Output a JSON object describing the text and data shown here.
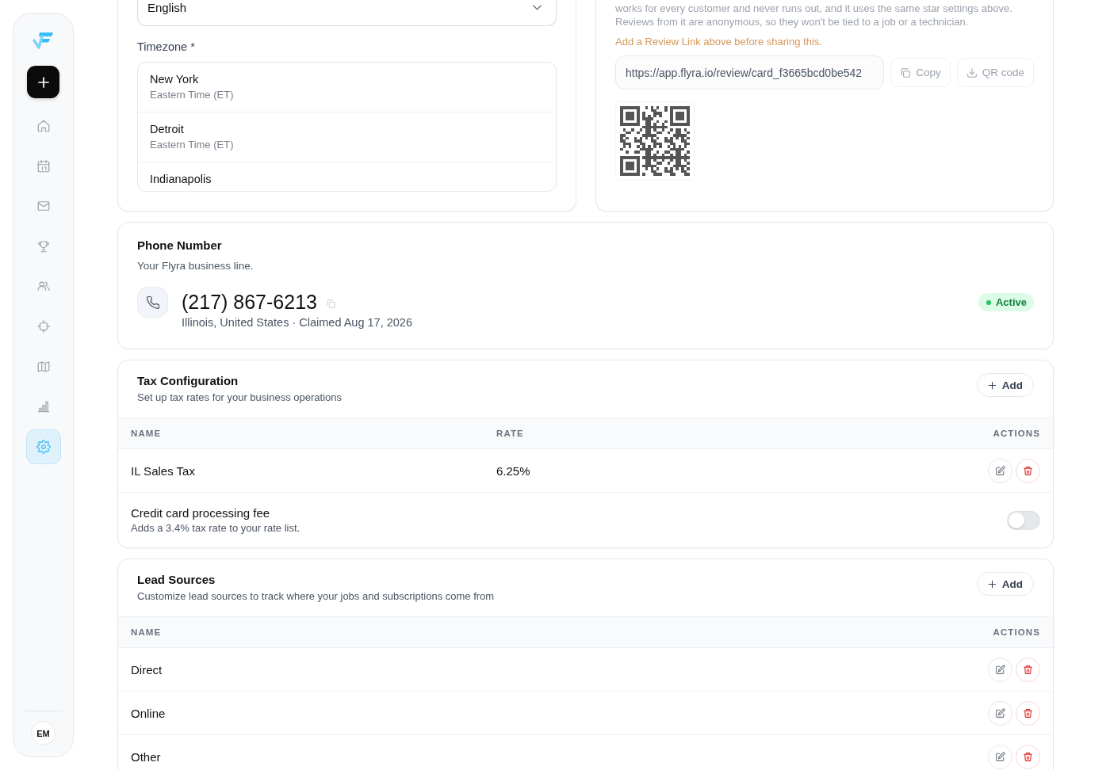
{
  "sidebar": {
    "items": [
      {
        "kind": "home",
        "selected": false
      },
      {
        "kind": "calendar",
        "selected": false
      },
      {
        "kind": "mail",
        "selected": false
      },
      {
        "kind": "trophy",
        "selected": false
      },
      {
        "kind": "users",
        "selected": false
      },
      {
        "kind": "target",
        "selected": false
      },
      {
        "kind": "map",
        "selected": false
      },
      {
        "kind": "chart",
        "selected": false
      },
      {
        "kind": "settings",
        "selected": true
      }
    ],
    "avatar": "EM"
  },
  "language": {
    "value": "English"
  },
  "timezone": {
    "label": "Timezone *",
    "options": [
      {
        "city": "New York",
        "zone": "Eastern Time (ET)"
      },
      {
        "city": "Detroit",
        "zone": "Eastern Time (ET)"
      },
      {
        "city": "Indianapolis"
      }
    ]
  },
  "review_card": {
    "description": "works for every customer and never runs out, and it uses the same star settings above. Reviews from it are anonymous, so they won't be tied to a job or a technician.",
    "warning": "Add a Review Link above before sharing this.",
    "link": "https://app.flyra.io/review/card_f3665bcd0be542",
    "buttons": [
      {
        "kind": "copy",
        "label": "Copy"
      },
      {
        "kind": "download",
        "label": "QR code"
      }
    ]
  },
  "phone": {
    "title": "Phone Number",
    "subtitle": "Your Flyra business line.",
    "number": "(217) 867-6213",
    "details": "Illinois, United States · Claimed Aug 17, 2026",
    "status": "Active",
    "active": true
  },
  "tax": {
    "title": "Tax Configuration",
    "subtitle": "Set up tax rates for your business operations",
    "add_button": "Add",
    "columns": [
      "NAME",
      "RATE",
      "ACTIONS"
    ],
    "rows": [
      {
        "name": "IL Sales Tax",
        "rate": "6.25%"
      }
    ],
    "fee": {
      "label": "Credit card processing fee",
      "description": "Adds a 3.4% tax rate to your rate list.",
      "on": false
    }
  },
  "lead_sources": {
    "title": "Lead Sources",
    "subtitle": "Customize lead sources to track where your jobs and subscriptions come from",
    "add_button": "Add",
    "columns": [
      "NAME",
      "ACTIONS"
    ],
    "rows": [
      {
        "name": "Direct"
      },
      {
        "name": "Online"
      },
      {
        "name": "Other"
      }
    ]
  }
}
